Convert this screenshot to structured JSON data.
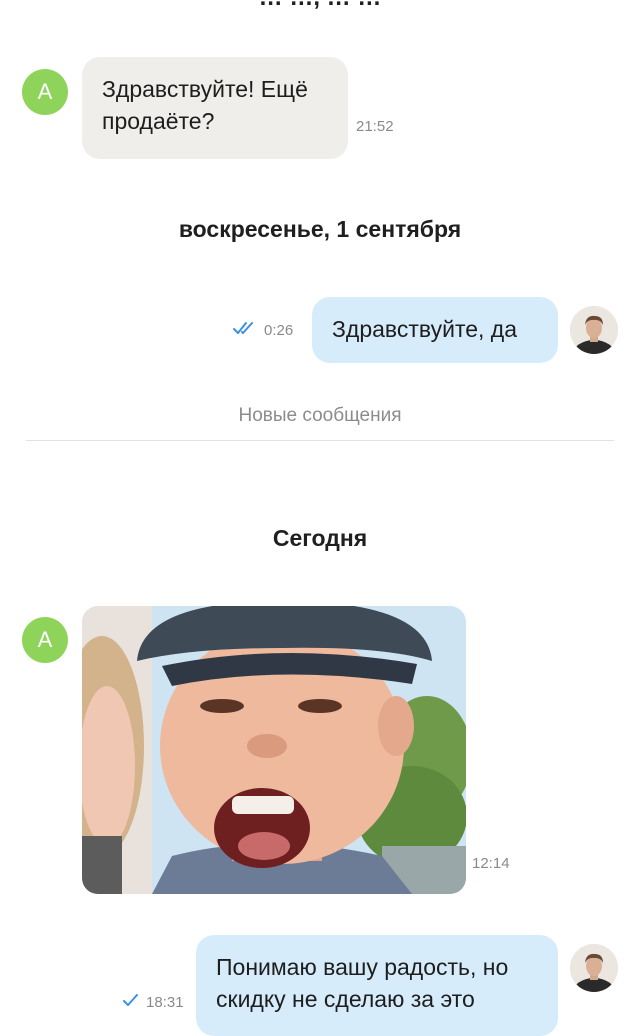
{
  "top_date_header": "… …, … …",
  "messages": [
    {
      "author_initial": "A",
      "text_lines": [
        "Здравствуйте! Ещё",
        "продаёте?"
      ],
      "time": "21:52"
    },
    {
      "text": "Здравствуйте, да",
      "time": "0:26",
      "status": "read"
    },
    {
      "author_initial": "A",
      "time": "12:14"
    },
    {
      "text_lines": [
        "Понимаю вашу радость, но",
        "скидку не сделаю за это"
      ],
      "time": "18:31",
      "status": "sent"
    }
  ],
  "date_separators": [
    "воскресенье, 1 сентября",
    "Сегодня"
  ],
  "new_messages_label": "Новые сообщения",
  "colors": {
    "avatar_green": "#8fd45a",
    "incoming_bubble": "#f0eeea",
    "outgoing_bubble": "#d6ecfb",
    "check_blue": "#3d8fe0"
  },
  "icons": {
    "read_status": "double-check-icon",
    "sent_status": "check-icon"
  }
}
